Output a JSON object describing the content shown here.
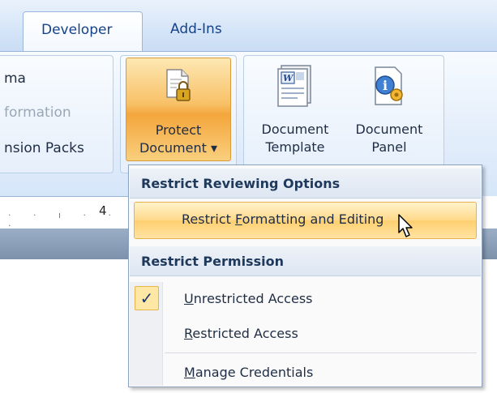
{
  "tabs": {
    "developer": "Developer",
    "addins": "Add-Ins"
  },
  "ribbon": {
    "left_group": {
      "line1": "ma",
      "line2": "formation",
      "line3": "nsion Packs"
    },
    "protect_document": {
      "line1": "Protect",
      "line2": "Document ▾",
      "icon": "protect-document-icon"
    },
    "document_template": {
      "line1": "Document",
      "line2": "Template",
      "icon": "document-template-icon"
    },
    "document_panel": {
      "line1": "Document",
      "line2": "Panel",
      "icon": "document-panel-icon"
    }
  },
  "ruler": {
    "number": "4"
  },
  "menu": {
    "section1_header": "Restrict Reviewing Options",
    "restrict_formatting": {
      "pre": "Restrict ",
      "ul": "F",
      "post": "ormatting and Editing"
    },
    "section2_header": "Restrict Permission",
    "unrestricted_access": {
      "ul": "U",
      "post": "nrestricted Access",
      "checked": true
    },
    "restricted_access": {
      "ul": "R",
      "post": "estricted Access"
    },
    "manage_credentials": {
      "ul": "M",
      "post": "anage Credentials"
    },
    "check_glyph": "✓"
  },
  "colors": {
    "accent_highlight": "#ffd98a",
    "ribbon_blue": "#d6e6f9",
    "text_blue": "#15428b"
  }
}
